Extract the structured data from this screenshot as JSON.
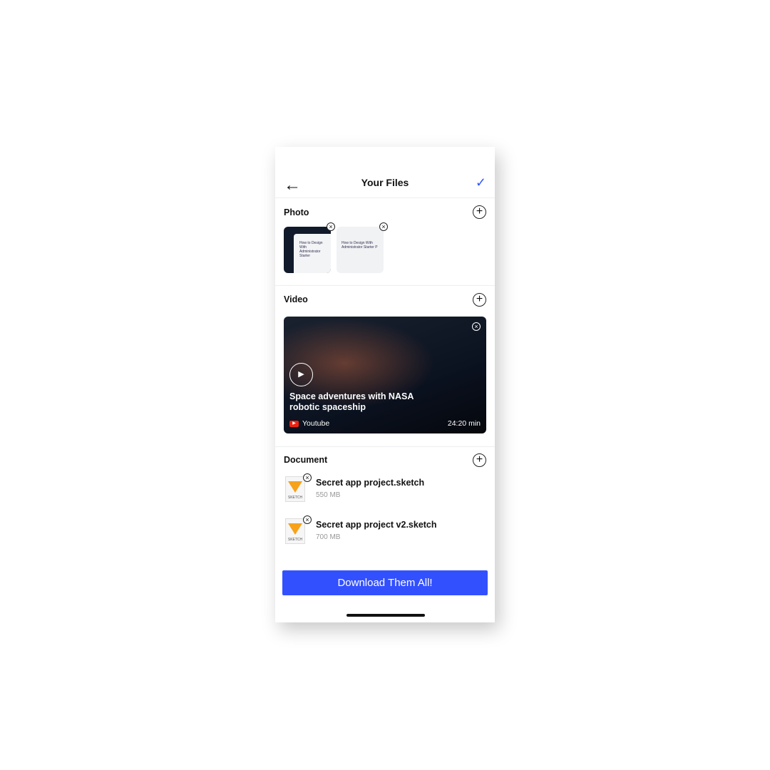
{
  "header": {
    "title": "Your Files",
    "back_icon": "arrow-left",
    "confirm_icon": "check"
  },
  "photo": {
    "title": "Photo",
    "thumbs": [
      {
        "text": "How to Design With Administrator Starter"
      },
      {
        "text": "How to Design With Administrator Starter P"
      }
    ]
  },
  "video": {
    "title": "Video",
    "item": {
      "title": "Space adventures with NASA robotic spaceship",
      "source": "Youtube",
      "duration": "24:20 min"
    }
  },
  "document": {
    "title": "Document",
    "items": [
      {
        "name": "Secret app project.sketch",
        "size": "550 MB",
        "icon_label": "SKETCH"
      },
      {
        "name": "Secret app project v2.sketch",
        "size": "700 MB",
        "icon_label": "SKETCH"
      }
    ]
  },
  "download_label": "Download Them All!",
  "colors": {
    "accent": "#3350ff"
  }
}
